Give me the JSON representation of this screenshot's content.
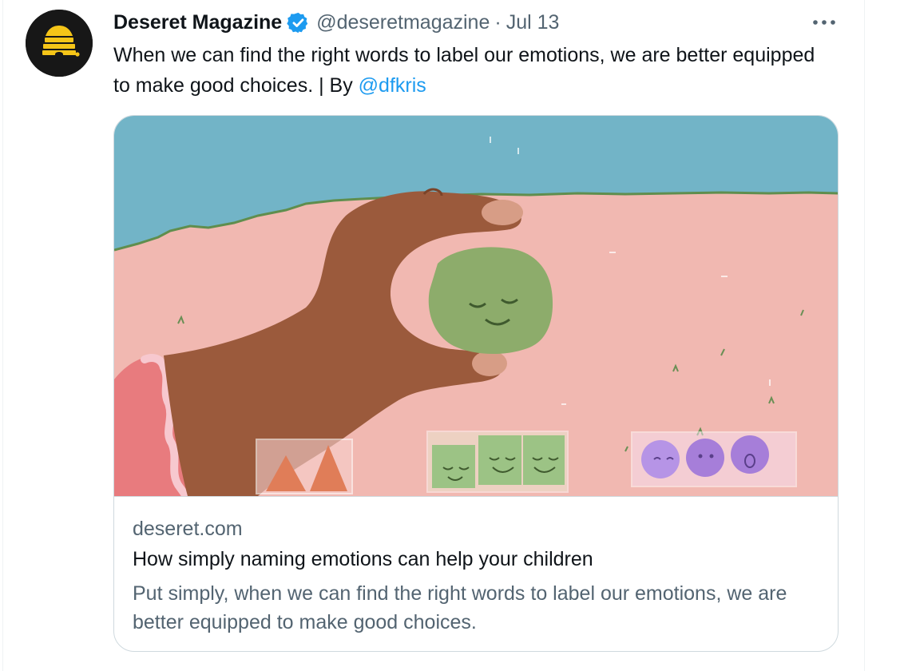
{
  "tweet": {
    "author": {
      "display_name": "Deseret Magazine",
      "handle": "@deseretmagazine",
      "verified": true
    },
    "separator": "·",
    "date": "Jul 13",
    "text": "When we can find the right words to label our emotions, we are better equipped to make good choices. | By ",
    "mention": "@dfkris",
    "more_icon": "more-horizontal-icon"
  },
  "card": {
    "domain": "deseret.com",
    "title": "How simply naming emotions can help your children",
    "description": "Put simply, when we can find the right words to label our emotions, we are better equipped to make good choices."
  },
  "colors": {
    "link": "#1d9bf0",
    "verified": "#1d9bf0",
    "secondary_text": "#536471",
    "primary_text": "#0f1419",
    "avatar_bg": "#171717",
    "avatar_logo": "#f5c518"
  }
}
